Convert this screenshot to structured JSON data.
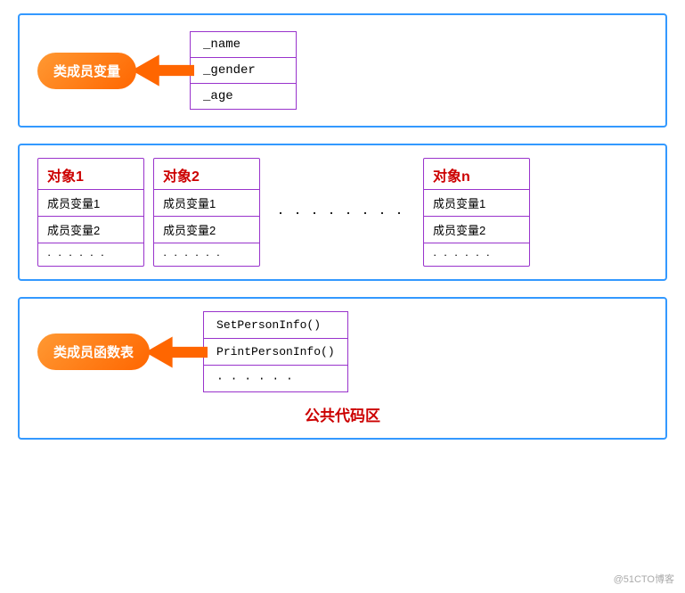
{
  "top": {
    "pill_label": "类成员变量",
    "variables": [
      "_name",
      "_gender",
      "_age"
    ]
  },
  "middle": {
    "objects": [
      {
        "title": "对象1",
        "members": [
          "成员变量1",
          "成员变量2"
        ],
        "dots": "· · · · · ·"
      },
      {
        "title": "对象2",
        "members": [
          "成员变量1",
          "成员变量2"
        ],
        "dots": "· · · · · ·"
      },
      {
        "title": "对象n",
        "members": [
          "成员变量1",
          "成员变量2"
        ],
        "dots": "· · · · · ·"
      }
    ],
    "ellipsis": "· · · · · · · ·"
  },
  "bottom": {
    "pill_label": "类成员函数表",
    "functions": [
      "SetPersonInfo()",
      "PrintPersonInfo()",
      "· · · · · ·"
    ],
    "public_label": "公共代码区"
  },
  "watermark": "@51CTO博客"
}
